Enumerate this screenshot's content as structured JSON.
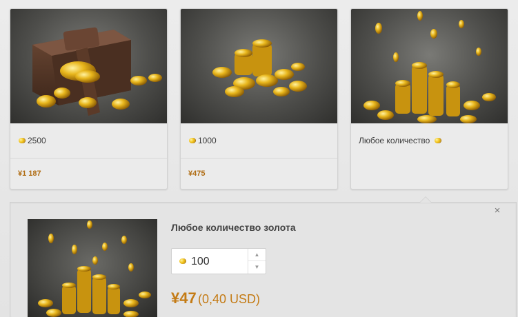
{
  "cards": [
    {
      "label": "2500",
      "price": "¥1 187"
    },
    {
      "label": "1000",
      "price": "¥475"
    },
    {
      "label": "Любое количество"
    }
  ],
  "panel": {
    "title": "Любое количество золота",
    "quantity": "100",
    "price": "¥47",
    "price_usd": "(0,40 USD)",
    "close_icon": "close-icon"
  },
  "colors": {
    "price": "#c47b15",
    "gold": "#f3c51e"
  }
}
